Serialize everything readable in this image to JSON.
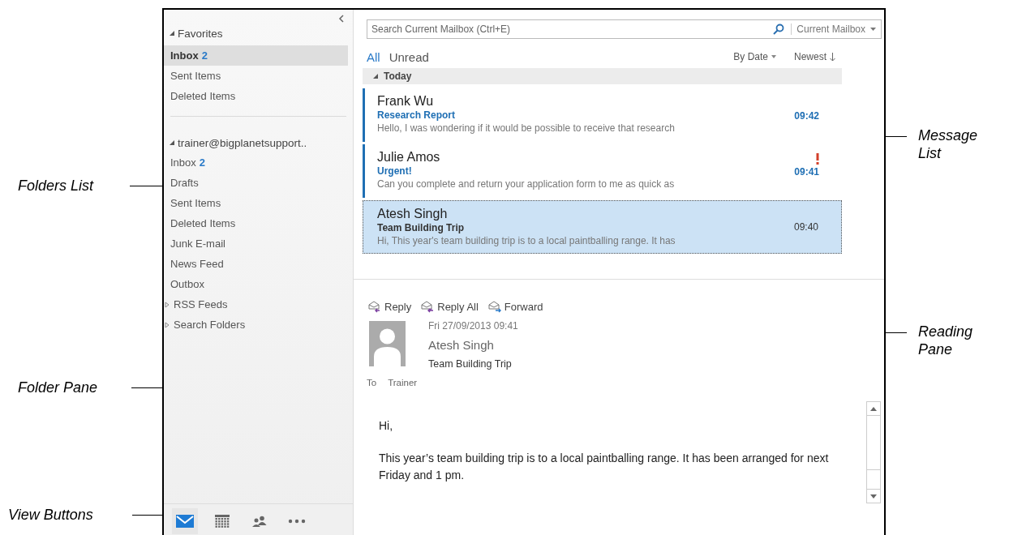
{
  "callouts": [
    {
      "text": "Folders List"
    },
    {
      "text": "Folder Pane"
    },
    {
      "text": "View Buttons"
    },
    {
      "text": "Message List"
    },
    {
      "text": "Reading Pane"
    }
  ],
  "folder_pane": {
    "sections": [
      {
        "label": "Favorites",
        "expanded": true,
        "items": [
          {
            "label": "Inbox",
            "count": "2",
            "selected": true,
            "kind": "folder"
          },
          {
            "label": "Sent Items",
            "selected": false,
            "kind": "folder"
          },
          {
            "label": "Deleted Items",
            "selected": false,
            "kind": "folder"
          }
        ]
      },
      {
        "label": "trainer@bigplanetsupport..",
        "expanded": true,
        "items": [
          {
            "label": "Inbox",
            "count": "2",
            "selected": false,
            "kind": "folder"
          },
          {
            "label": "Drafts",
            "selected": false,
            "kind": "folder"
          },
          {
            "label": "Sent Items",
            "selected": false,
            "kind": "folder"
          },
          {
            "label": "Deleted Items",
            "selected": false,
            "kind": "folder"
          },
          {
            "label": "Junk E-mail",
            "selected": false,
            "kind": "folder"
          },
          {
            "label": "News Feed",
            "selected": false,
            "kind": "folder"
          },
          {
            "label": "Outbox",
            "selected": false,
            "kind": "folder"
          },
          {
            "label": "RSS Feeds",
            "selected": false,
            "kind": "collapsed"
          },
          {
            "label": "Search Folders",
            "selected": false,
            "kind": "collapsed"
          }
        ]
      }
    ],
    "view_buttons": [
      {
        "kind": "mail",
        "selected": true
      },
      {
        "kind": "calendar",
        "selected": false
      },
      {
        "kind": "people",
        "selected": false
      },
      {
        "kind": "more",
        "selected": false
      }
    ]
  },
  "search": {
    "placeholder": "Search Current Mailbox (Ctrl+E)",
    "scope": "Current Mailbox"
  },
  "filters": [
    {
      "label": "All",
      "selected": true
    },
    {
      "label": "Unread",
      "selected": false
    }
  ],
  "sort": {
    "by": "By Date",
    "order": "Newest"
  },
  "group": {
    "label": "Today",
    "expanded": true
  },
  "messages": [
    {
      "sender": "Frank Wu",
      "subject": "Research Report",
      "preview": "Hello,  I was wondering if it would be possible to receive that research",
      "time": "09:42",
      "unread": true,
      "important": false,
      "selected": false
    },
    {
      "sender": "Julie Amos",
      "subject": "Urgent!",
      "preview": "Can you complete and return your application form to me as quick as",
      "time": "09:41",
      "unread": true,
      "important": true,
      "selected": false
    },
    {
      "sender": "Atesh Singh",
      "subject": "Team Building Trip",
      "preview": "Hi,  This year's team building trip is to a local paintballing range. It has",
      "time": "09:40",
      "unread": false,
      "important": false,
      "selected": true
    }
  ],
  "reading_pane": {
    "actions": [
      {
        "label": "Reply",
        "kind": "reply"
      },
      {
        "label": "Reply All",
        "kind": "reply_all"
      },
      {
        "label": "Forward",
        "kind": "forward"
      }
    ],
    "date": "Fri 27/09/2013 09:41",
    "sender": "Atesh Singh",
    "subject": "Team Building Trip",
    "to_label": "To",
    "to": "Trainer",
    "body": [
      "Hi,",
      "This year’s team building trip is to a local paintballing range. It has been arranged for next Friday and 1 pm."
    ]
  }
}
